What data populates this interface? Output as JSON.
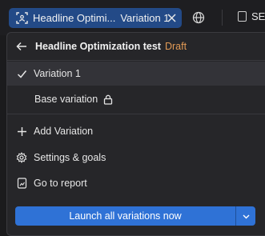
{
  "topbar": {
    "experiment_title": "Headline Optimi...",
    "variation_name": "Variation 1",
    "right_button_label": "SE"
  },
  "panel": {
    "title": "Headline Optimization test",
    "status": "Draft",
    "variations": [
      {
        "label": "Variation 1",
        "selected": true
      },
      {
        "label": "Base variation",
        "locked": true
      }
    ],
    "actions": [
      {
        "label": "Add Variation",
        "icon": "plus-icon"
      },
      {
        "label": "Settings & goals",
        "icon": "gear-icon"
      },
      {
        "label": "Go to report",
        "icon": "report-icon"
      }
    ],
    "launch_label": "Launch all variations now"
  },
  "colors": {
    "accent": "#2f72d6",
    "pill": "#234a87",
    "draft": "#e29a55",
    "background": "#262629"
  }
}
